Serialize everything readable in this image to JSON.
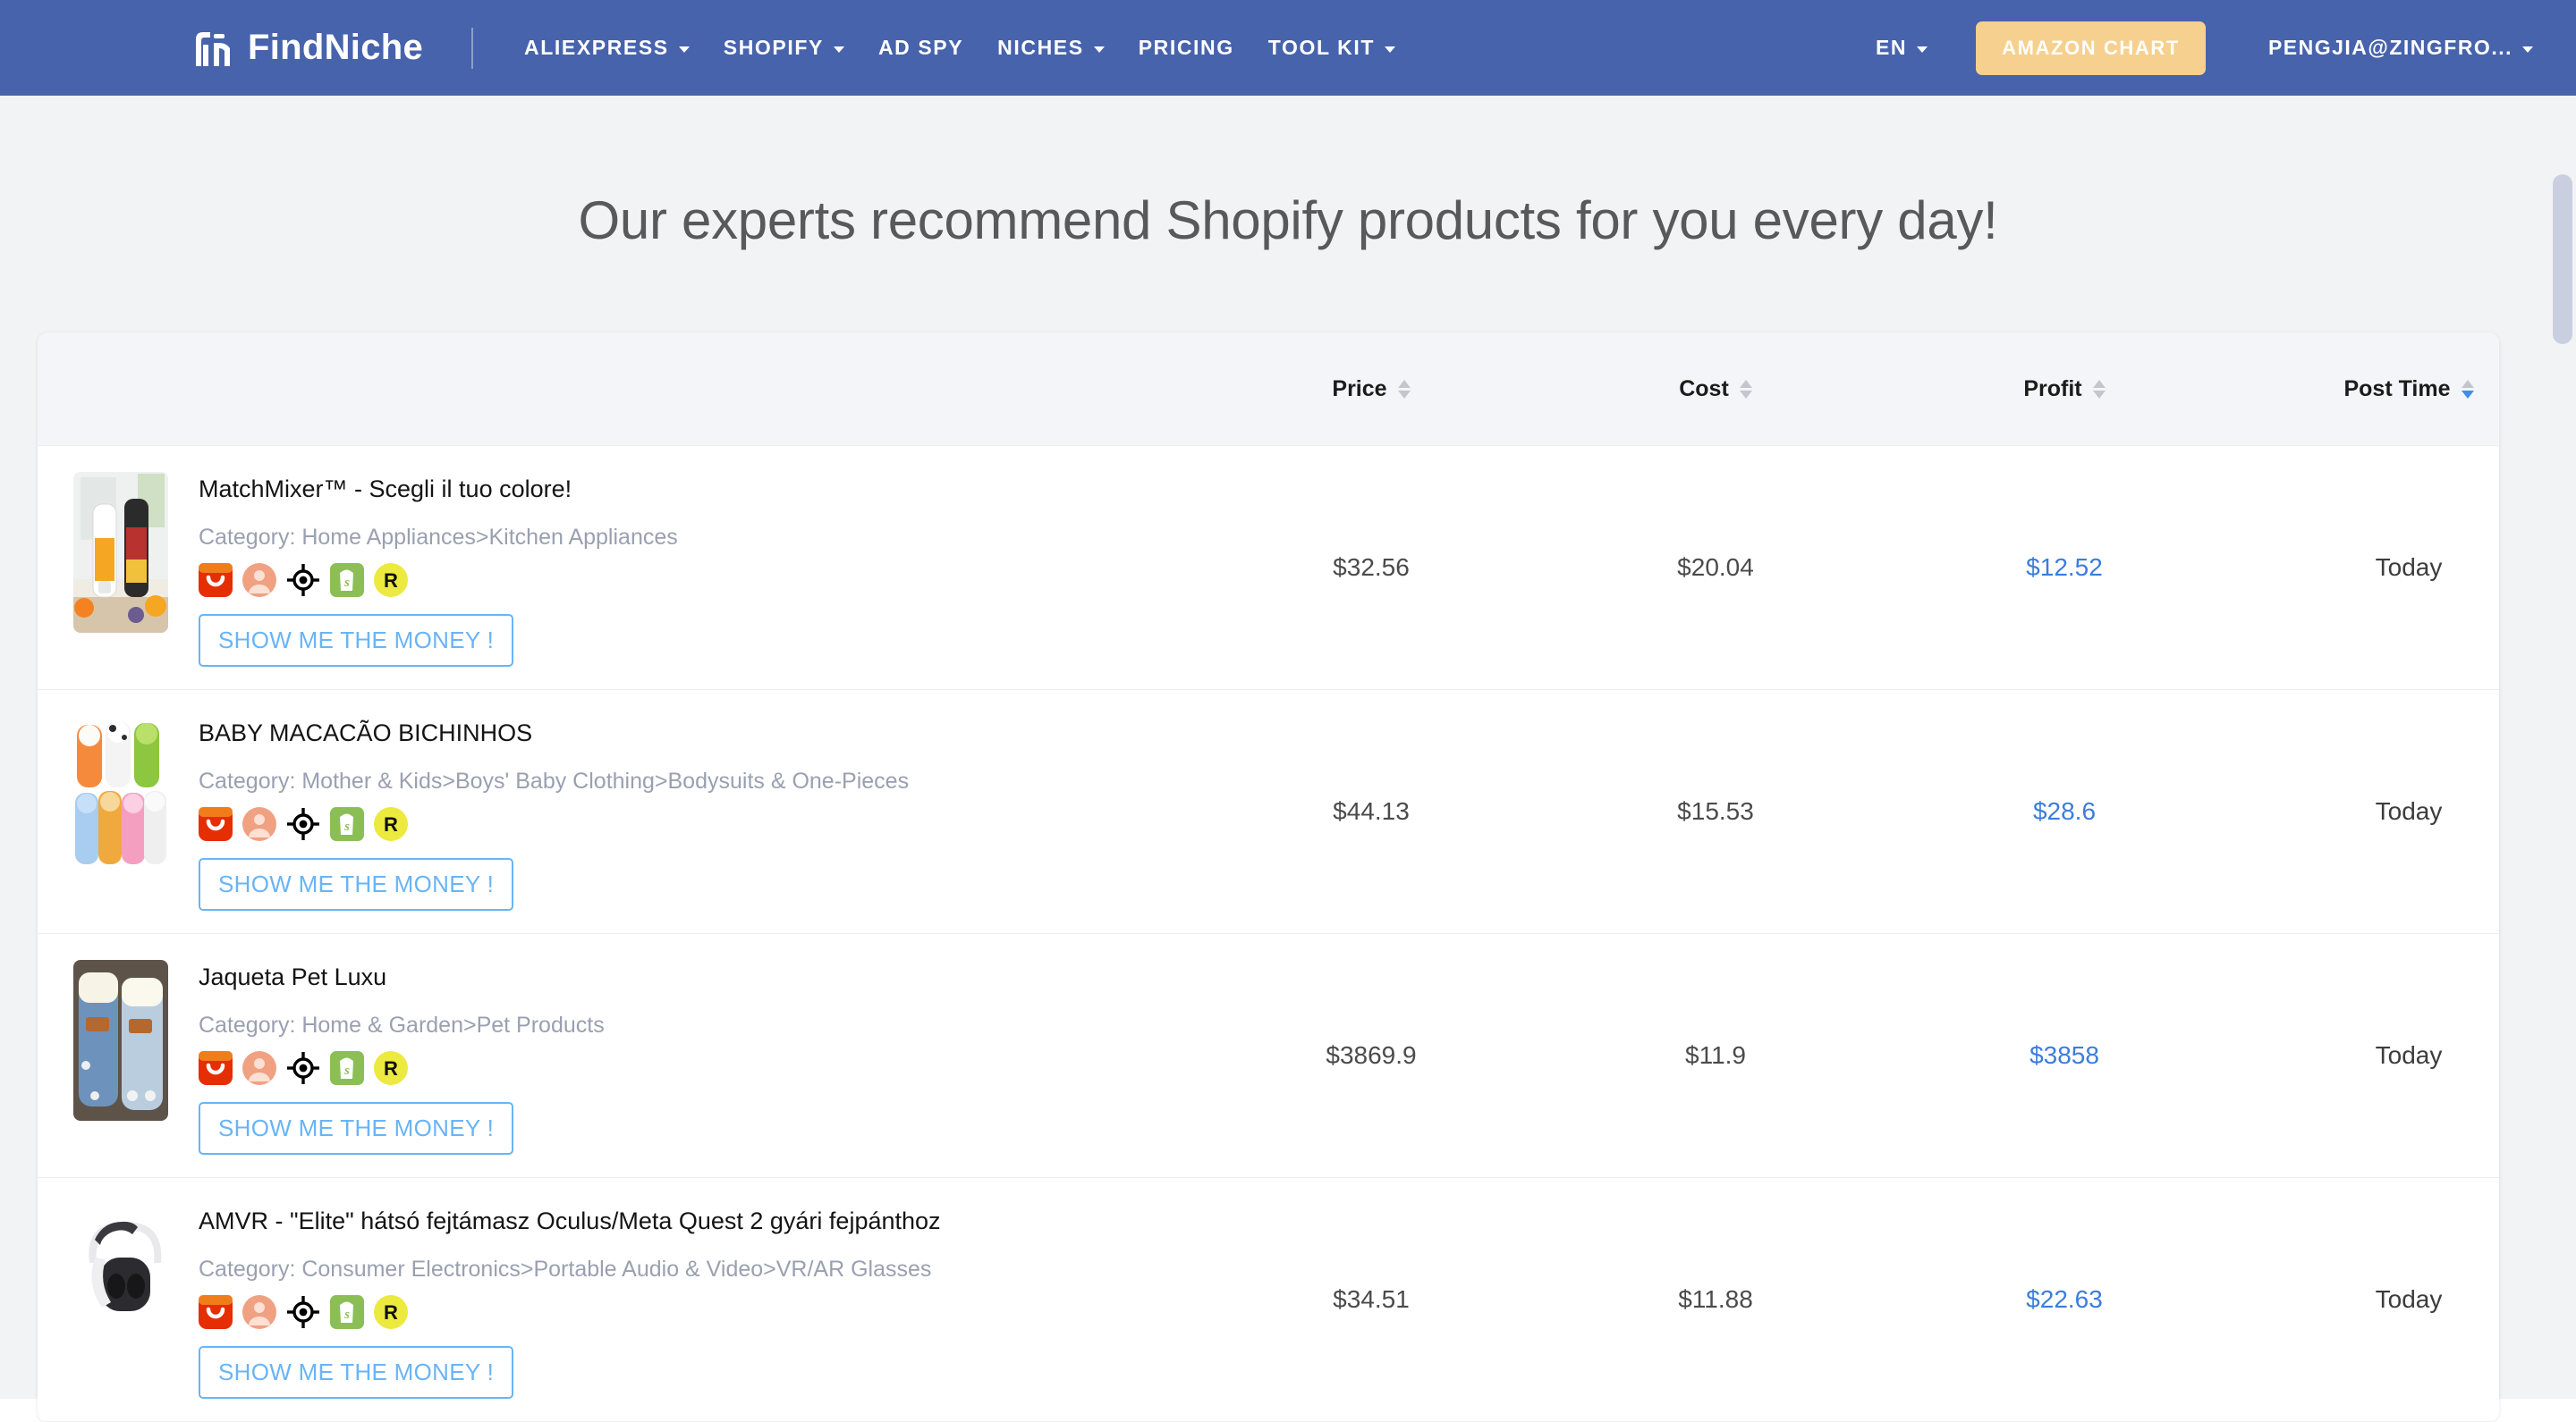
{
  "nav": {
    "brand": "FindNiche",
    "brand_logo_icon": "findniche-logo-icon",
    "items": [
      {
        "label": "ALIEXPRESS",
        "caret": true
      },
      {
        "label": "SHOPIFY",
        "caret": true
      },
      {
        "label": "AD SPY",
        "caret": false
      },
      {
        "label": "NICHES",
        "caret": true
      },
      {
        "label": "PRICING",
        "caret": false
      },
      {
        "label": "TOOL KIT",
        "caret": true
      }
    ],
    "language": "EN",
    "amazon_chart": "AMAZON CHART",
    "account": "PENGJIA@ZINGFRO...",
    "bar_color": "#4763ac",
    "amazon_btn_color": "#f6d08e"
  },
  "heading": "Our experts recommend Shopify products for you every day!",
  "table": {
    "columns": [
      {
        "label": "Price",
        "sorted": false
      },
      {
        "label": "Cost",
        "sorted": false
      },
      {
        "label": "Profit",
        "sorted": false
      },
      {
        "label": "Post Time",
        "sorted": true,
        "direction": "desc"
      }
    ],
    "accent_link_color": "#3b7ddd",
    "button_color": "#69b4f7",
    "category_prefix": "Category: ",
    "cta_label": "SHOW ME THE MONEY !",
    "badge_icons": [
      "aliexpress-icon",
      "user-profile-icon",
      "target-crosshair-icon",
      "shopify-icon",
      "r-rank-icon"
    ],
    "rows": [
      {
        "thumb_icon": "portable-blender-photo",
        "title": "MatchMixer™ - Scegli il tuo colore!",
        "category": "Home Appliances>Kitchen Appliances",
        "price": "$32.56",
        "cost": "$20.04",
        "profit": "$12.52",
        "post_time": "Today"
      },
      {
        "thumb_icon": "baby-animal-onesies-photo",
        "title": "BABY MACACÃO BICHINHOS",
        "category": "Mother & Kids>Boys' Baby Clothing>Bodysuits & One-Pieces",
        "price": "$44.13",
        "cost": "$15.53",
        "profit": "$28.6",
        "post_time": "Today"
      },
      {
        "thumb_icon": "denim-pet-jacket-photo",
        "title": "Jaqueta Pet Luxu",
        "category": "Home & Garden>Pet Products",
        "price": "$3869.9",
        "cost": "$11.9",
        "profit": "$3858",
        "post_time": "Today"
      },
      {
        "thumb_icon": "vr-headstrap-photo",
        "title": "AMVR - \"Elite\" hátsó fejtámasz Oculus/Meta Quest 2 gyári fejpánthoz",
        "category": "Consumer Electronics>Portable Audio & Video>VR/AR Glasses",
        "price": "$34.51",
        "cost": "$11.88",
        "profit": "$22.63",
        "post_time": "Today"
      }
    ]
  }
}
